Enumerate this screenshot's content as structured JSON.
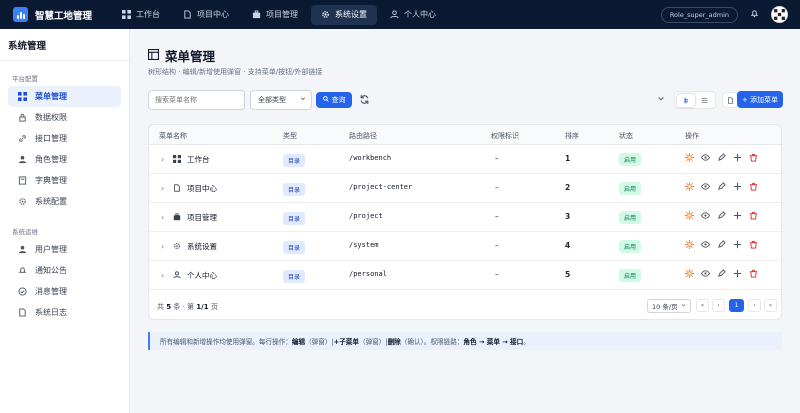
{
  "app": {
    "title": "智慧工地管理"
  },
  "nav": [
    {
      "label": "工作台",
      "icon": "grid-icon"
    },
    {
      "label": "项目中心",
      "icon": "document-icon"
    },
    {
      "label": "项目管理",
      "icon": "briefcase-icon"
    },
    {
      "label": "系统设置",
      "icon": "gear-icon"
    },
    {
      "label": "个人中心",
      "icon": "user-icon"
    }
  ],
  "topbar": {
    "role": "Role_super_admin"
  },
  "sidebar": {
    "title": "系统管理",
    "group1": "平台配置",
    "group2": "系统运维",
    "items1": [
      {
        "label": "菜单管理"
      },
      {
        "label": "数据权限"
      },
      {
        "label": "接口管理"
      },
      {
        "label": "角色管理"
      },
      {
        "label": "字典管理"
      },
      {
        "label": "系统配置"
      }
    ],
    "items2": [
      {
        "label": "用户管理"
      },
      {
        "label": "通知公告"
      },
      {
        "label": "消息管理"
      },
      {
        "label": "系统日志"
      }
    ]
  },
  "page": {
    "title": "菜单管理",
    "subtitle": "树形结构 · 编辑/新增使用弹窗 · 支持菜单/按钮/外部链接"
  },
  "toolbar": {
    "search_placeholder": "搜索菜单名称",
    "type_select": "全部类型",
    "search_label": "查询",
    "add_label": "+ 添加菜单"
  },
  "table": {
    "headers": {
      "name": "菜单名称",
      "type": "类型",
      "path": "路由路径",
      "perm": "权限标识",
      "sort": "排序",
      "status": "状态",
      "actions": "操作"
    },
    "rows": [
      {
        "name": "工作台",
        "type": "目录",
        "path": "/workbench",
        "perm": "–",
        "sort": "1",
        "status": "启用"
      },
      {
        "name": "项目中心",
        "type": "目录",
        "path": "/project-center",
        "perm": "–",
        "sort": "2",
        "status": "启用"
      },
      {
        "name": "项目管理",
        "type": "目录",
        "path": "/project",
        "perm": "–",
        "sort": "3",
        "status": "启用"
      },
      {
        "name": "系统设置",
        "type": "目录",
        "path": "/system",
        "perm": "–",
        "sort": "4",
        "status": "启用"
      },
      {
        "name": "个人中心",
        "type": "目录",
        "path": "/personal",
        "perm": "–",
        "sort": "5",
        "status": "启用"
      }
    ]
  },
  "pager": {
    "prefix": "共",
    "count": "5",
    "mid": "条 · 第",
    "page": "1/1",
    "suffix": "页",
    "size": "10 条/页",
    "first": "«",
    "prev": "‹",
    "current": "1",
    "next": "›",
    "last": "»"
  },
  "note": {
    "t1": "所有编辑和新增操作均使用弹窗。每行操作：",
    "b1": "编辑",
    "t2": "（弹窗）|",
    "b2": "+子菜单",
    "t3": "（弹窗）|",
    "b3": "删除",
    "t4": "（确认）。权限链路：",
    "b4": "角色 → 菜单 → 接口",
    "t5": "。"
  },
  "colors": {
    "accent": "#2563eb",
    "topbar": "#0b1a33",
    "status_ok": "#047857",
    "danger": "#dc2626",
    "toggle": "#f97316"
  }
}
